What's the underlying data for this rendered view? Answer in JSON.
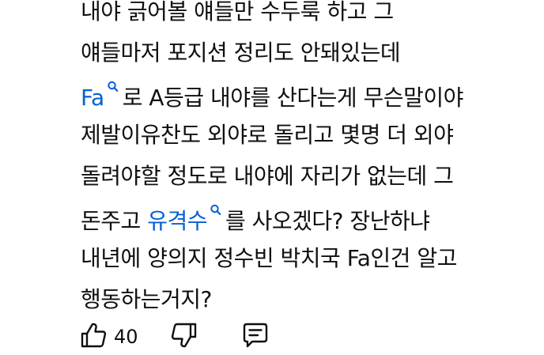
{
  "comment": {
    "line1": "내야 긁어볼 얘들만 수두룩 하고 그",
    "line2": "얘들마저 포지션 정리도 안돼있는데",
    "line3_link": "Fa",
    "line3_rest": "로 A등급 내야를 산다는게 무슨말이야",
    "line4": "제발이유찬도 외야로 돌리고 몇명 더 외야",
    "line5": "돌려야할 정도로 내야에 자리가 없는데 그",
    "line6_pre": "돈주고 ",
    "line6_link": "유격수",
    "line6_post": "를 사오겠다? 장난하냐",
    "line7": "내년에 양의지 정수빈 박치국 Fa인건 알고",
    "line8": "행동하는거지?"
  },
  "actions": {
    "like_count": "40",
    "like_icon": "thumbs-up-icon",
    "dislike_icon": "thumbs-down-icon",
    "reply_icon": "comment-icon"
  },
  "colors": {
    "text": "#0f0f0f",
    "link": "#065fd4",
    "background": "#ffffff"
  }
}
